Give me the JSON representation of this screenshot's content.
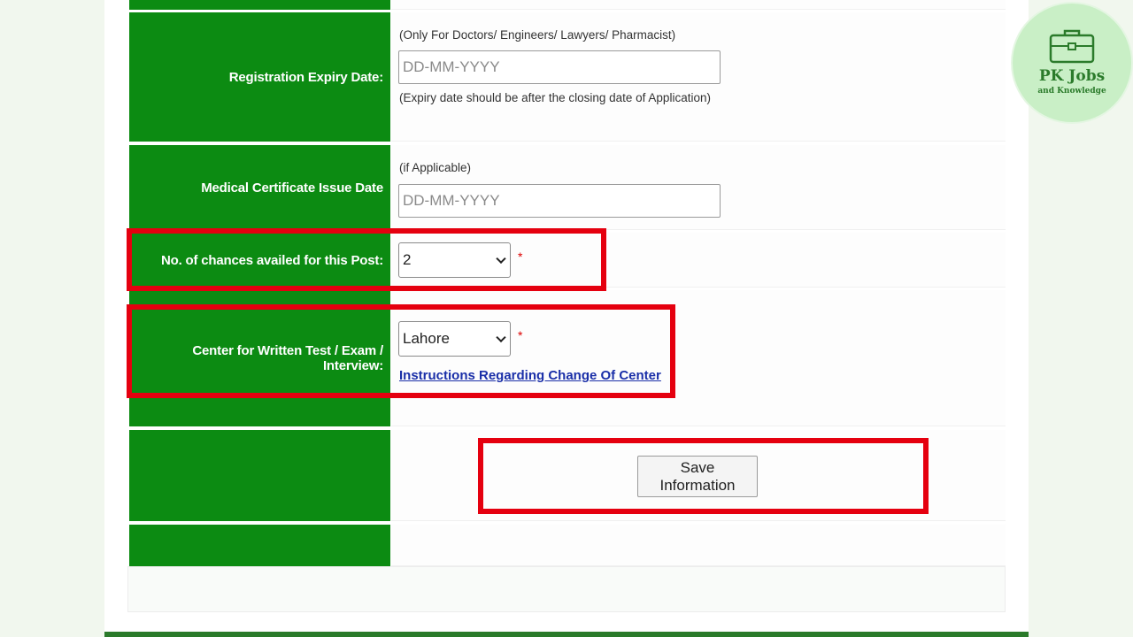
{
  "form": {
    "registration_expiry": {
      "label": "Registration Expiry Date:",
      "note_top": "(Only For Doctors/ Engineers/ Lawyers/ Pharmacist)",
      "placeholder": "DD-MM-YYYY",
      "note_bottom": "(Expiry date should be after the closing date of Application)"
    },
    "medical_certificate": {
      "label": "Medical Certificate Issue Date",
      "note_top": "(if Applicable)",
      "placeholder": "DD-MM-YYYY"
    },
    "chances": {
      "label": "No. of chances availed for this Post:",
      "selected": "2",
      "required_mark": "*"
    },
    "center": {
      "label": "Center for Written Test / Exam / Interview:",
      "selected": "Lahore",
      "required_mark": "*",
      "link_text": "Instructions Regarding Change Of Center"
    },
    "save_label": "Save Information"
  },
  "watermark": {
    "title": "PK Jobs",
    "subtitle": "and Knowledge",
    "icon": "briefcase-icon"
  },
  "colors": {
    "label_bg": "#0c8b12",
    "highlight": "#e5000f",
    "link": "#1a2fa8"
  }
}
